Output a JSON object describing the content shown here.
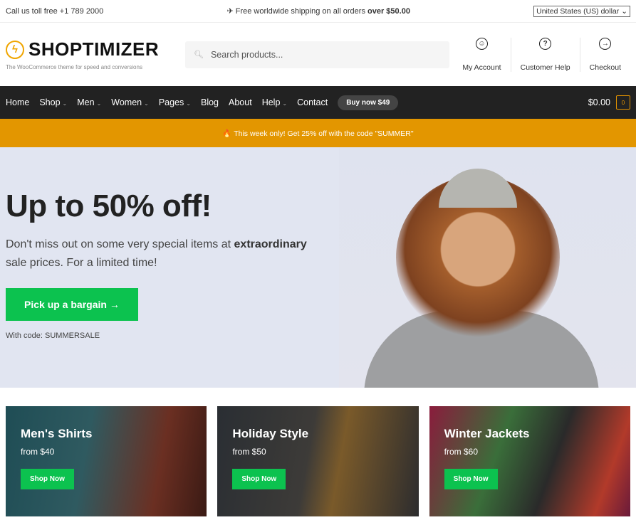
{
  "topbar": {
    "phone": "Call us toll free +1 789 2000",
    "shipping_prefix": "✈ Free worldwide shipping on all orders ",
    "shipping_bold": "over $50.00",
    "currency": "United States (US) dollar"
  },
  "header": {
    "logo": "SHOPTIMIZER",
    "tagline": "The WooCommerce theme for speed and conversions",
    "search_placeholder": "Search products...",
    "links": [
      {
        "label": "My Account",
        "icon": "user-icon"
      },
      {
        "label": "Customer Help",
        "icon": "help-icon"
      },
      {
        "label": "Checkout",
        "icon": "arrow-right-icon"
      }
    ]
  },
  "nav": {
    "items": [
      {
        "label": "Home"
      },
      {
        "label": "Shop",
        "dropdown": true
      },
      {
        "label": "Men",
        "dropdown": true
      },
      {
        "label": "Women",
        "dropdown": true
      },
      {
        "label": "Pages",
        "dropdown": true
      },
      {
        "label": "Blog"
      },
      {
        "label": "About"
      },
      {
        "label": "Help",
        "dropdown": true
      },
      {
        "label": "Contact"
      }
    ],
    "buy": "Buy now $49",
    "cart_total": "$0.00",
    "cart_count": "0"
  },
  "promo": "🔥 This week only! Get 25% off with the code \"SUMMER\"",
  "hero": {
    "title": "Up to 50% off!",
    "text_1": "Don't miss out on some very special items at ",
    "text_bold": "extraordinary",
    "text_2": " sale prices. For a limited time!",
    "cta": "Pick up a bargain →",
    "code": "With code: SUMMERSALE"
  },
  "categories": [
    {
      "title": "Men's Shirts",
      "price": "from $40",
      "button": "Shop Now"
    },
    {
      "title": "Holiday Style",
      "price": "from $50",
      "button": "Shop Now"
    },
    {
      "title": "Winter Jackets",
      "price": "from $60",
      "button": "Shop Now"
    }
  ],
  "colors": {
    "accent": "#0cc24f",
    "promo": "#e39600",
    "nav": "#222222",
    "brand": "#f0a500"
  }
}
